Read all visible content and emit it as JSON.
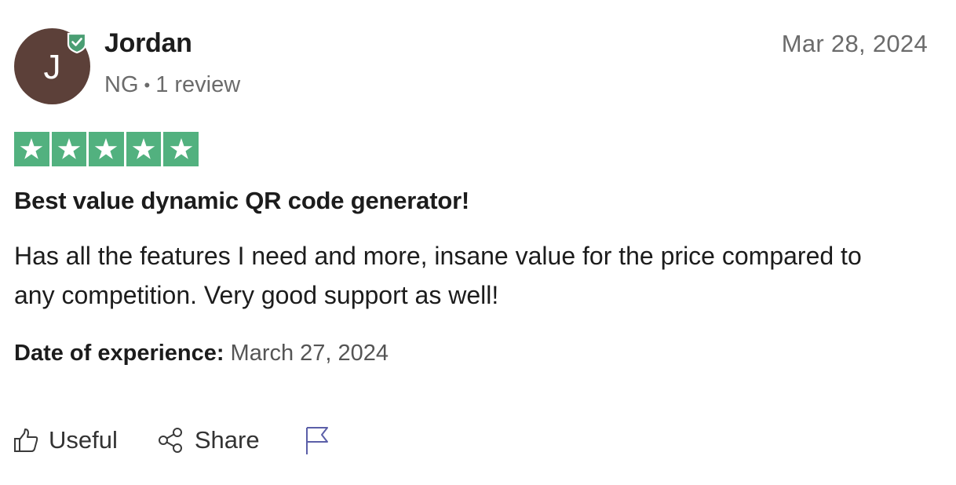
{
  "reviewer": {
    "avatar_initial": "J",
    "avatar_color": "#5c4039",
    "name": "Jordan",
    "country": "NG",
    "separator": "•",
    "review_count": "1 review",
    "verified_icon": "verified-check-icon"
  },
  "review": {
    "date": "Mar 28, 2024",
    "rating": 5,
    "rating_max": 5,
    "star_color": "#52b17f",
    "title": "Best value dynamic QR code generator!",
    "body": "Has all the features I need and more, insane value for the price compared to any competition. Very good support as well!",
    "experience_label": "Date of experience:",
    "experience_date": "March 27, 2024"
  },
  "actions": {
    "useful_label": "Useful",
    "useful_icon": "thumbs-up-icon",
    "share_label": "Share",
    "share_icon": "share-icon",
    "report_icon": "flag-icon"
  }
}
